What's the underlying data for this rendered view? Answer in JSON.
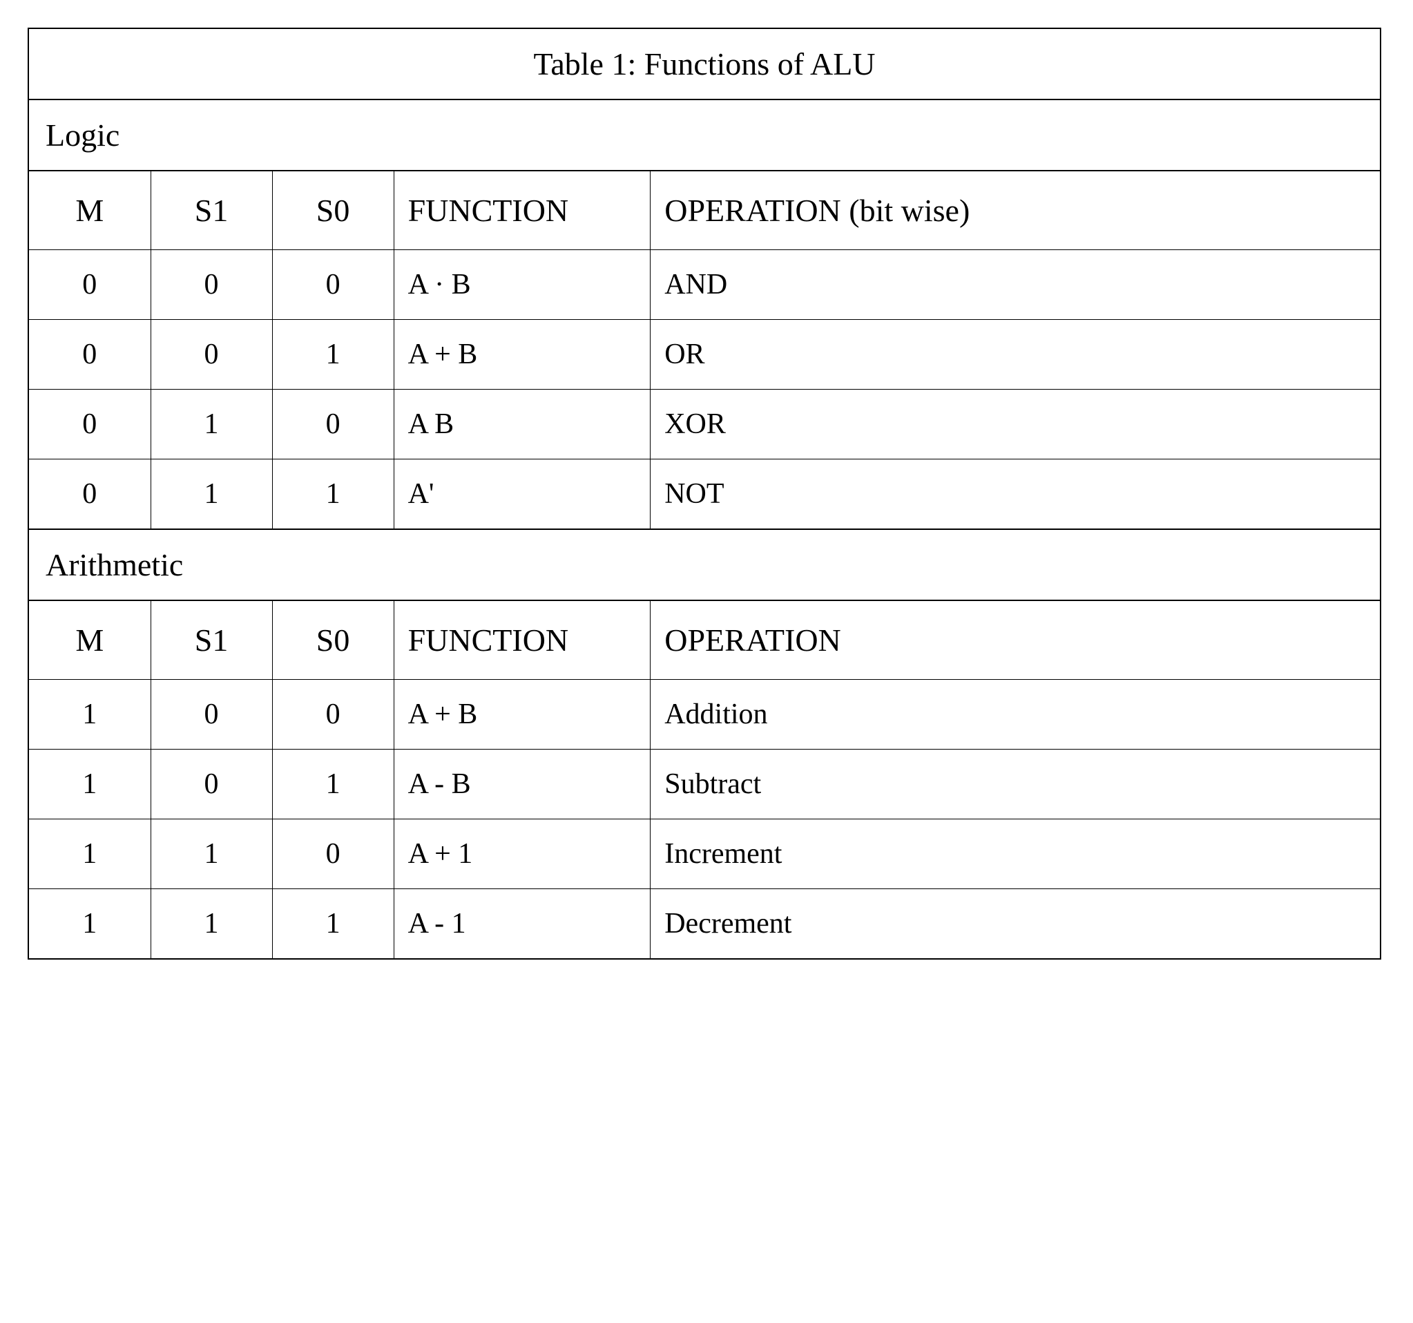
{
  "title": "Table 1: Functions of ALU",
  "sections": [
    {
      "name": "Logic",
      "headers": {
        "m": "M",
        "s1": "S1",
        "s0": "S0",
        "func": "FUNCTION",
        "op": "OPERATION (bit wise)"
      },
      "rows": [
        {
          "m": "0",
          "s1": "0",
          "s0": "0",
          "func": "A · B",
          "op": "AND"
        },
        {
          "m": "0",
          "s1": "0",
          "s0": "1",
          "func": "A + B",
          "op": "OR"
        },
        {
          "m": "0",
          "s1": "1",
          "s0": "0",
          "func": "A  B",
          "op": "XOR"
        },
        {
          "m": "0",
          "s1": "1",
          "s0": "1",
          "func": "A'",
          "op": "NOT"
        }
      ]
    },
    {
      "name": "Arithmetic",
      "headers": {
        "m": "M",
        "s1": "S1",
        "s0": "S0",
        "func": "FUNCTION",
        "op": "OPERATION"
      },
      "rows": [
        {
          "m": "1",
          "s1": "0",
          "s0": "0",
          "func": "A + B",
          "op": "Addition"
        },
        {
          "m": "1",
          "s1": "0",
          "s0": "1",
          "func": "A - B",
          "op": "Subtract"
        },
        {
          "m": "1",
          "s1": "1",
          "s0": "0",
          "func": "A + 1",
          "op": "Increment"
        },
        {
          "m": "1",
          "s1": "1",
          "s0": "1",
          "func": "A - 1",
          "op": "Decrement"
        }
      ]
    }
  ]
}
